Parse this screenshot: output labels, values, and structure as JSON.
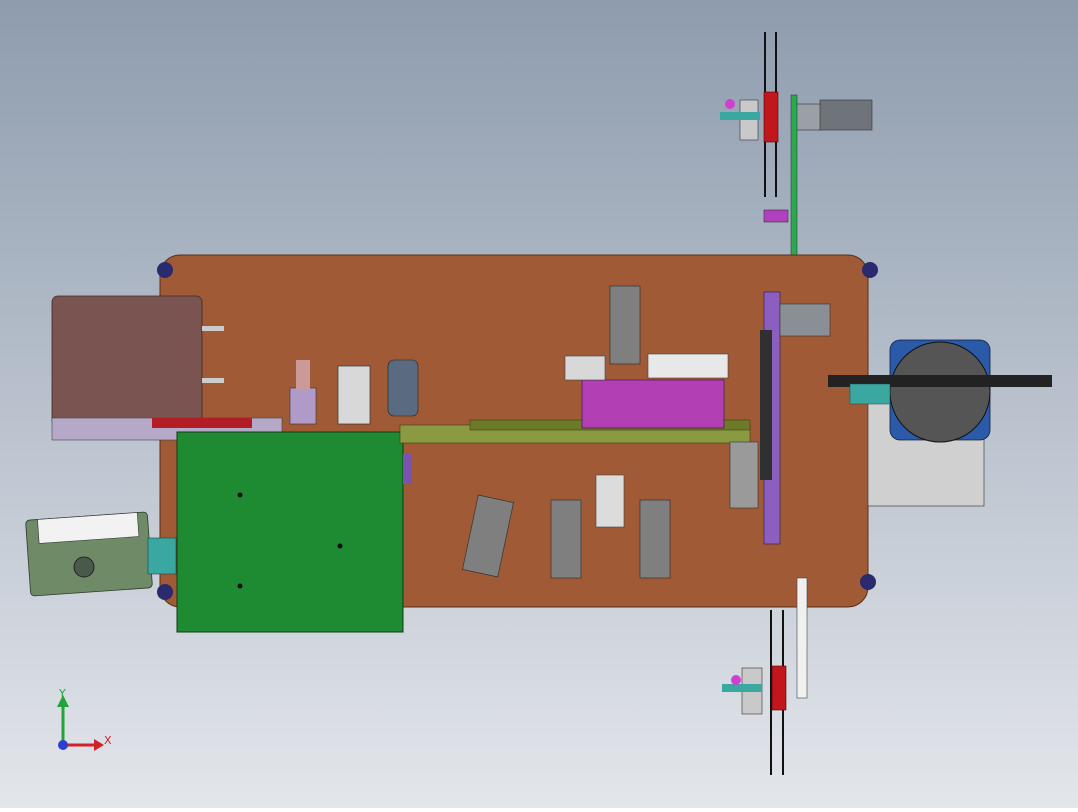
{
  "viewport": {
    "background_top": "#8e9cae",
    "background_bottom": "#e3e6eb"
  },
  "colors": {
    "base_plate": "#a05a35",
    "left_brown_block": "#7a5450",
    "green_board": "#1e8a32",
    "olive_rail": "#6d7a28",
    "magenta": "#b23fb3",
    "gray_part": "#7f7f7f",
    "purple_rack": "#8a5fc0",
    "steel_blue": "#2a5aa8",
    "light_gray": "#d0d0d0",
    "red_disk": "#c0161c",
    "teal": "#3aa8a0",
    "label_green": "#6e8a66"
  },
  "triad": {
    "x_label": "X",
    "y_label": "Y",
    "x_color": "#d0222a",
    "y_color": "#22a43a",
    "origin_color": "#2a3fd0"
  }
}
